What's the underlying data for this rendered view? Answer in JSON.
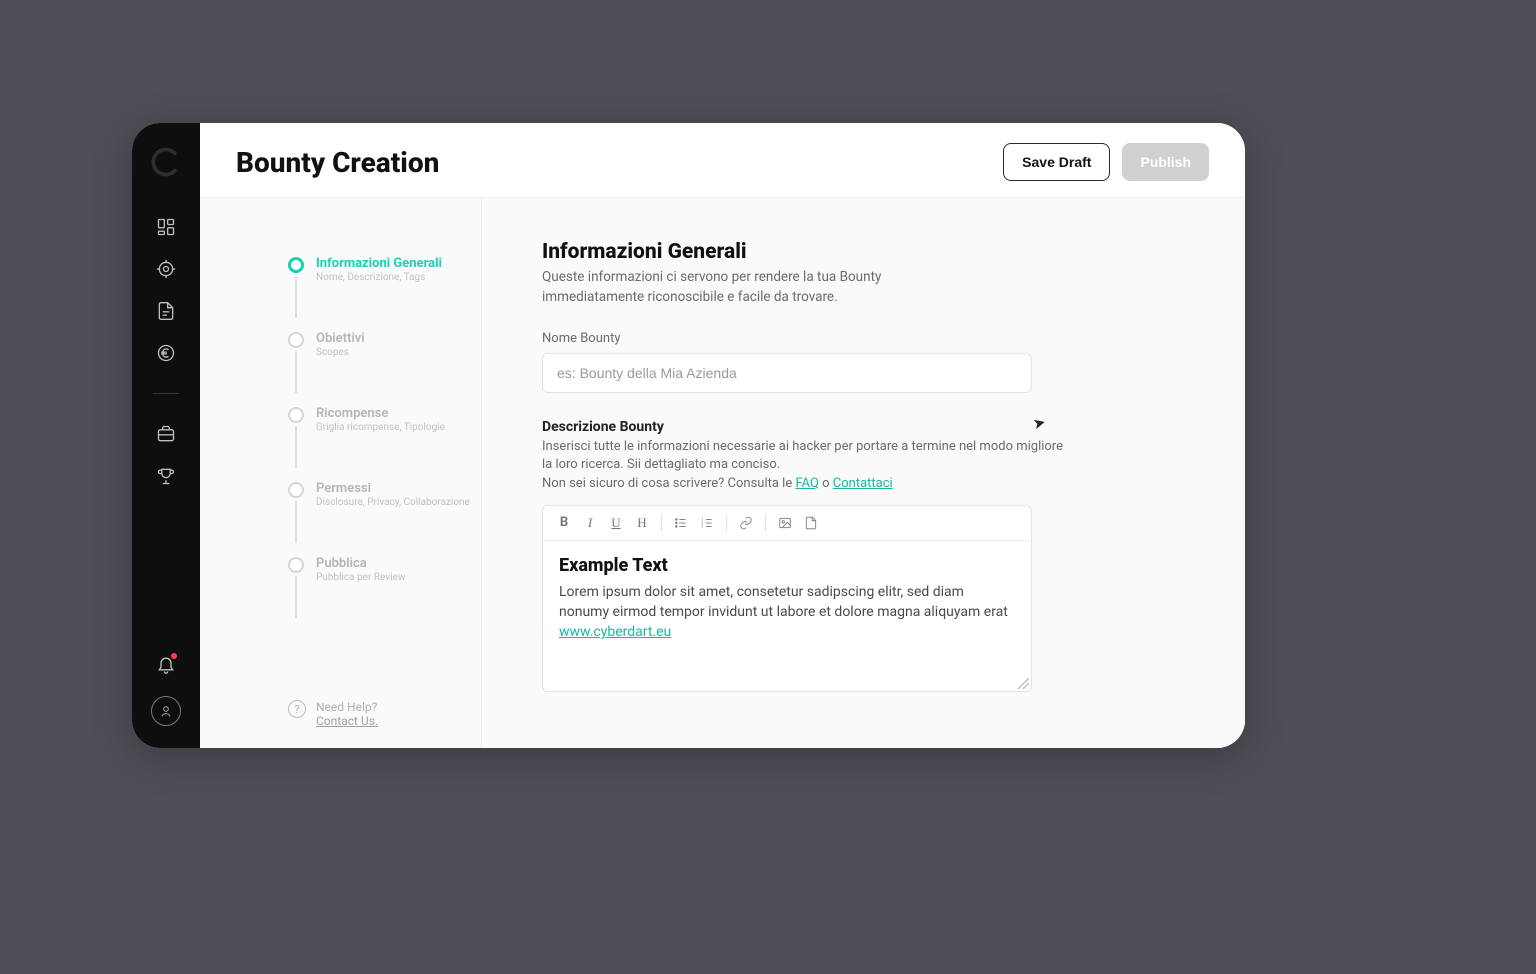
{
  "header": {
    "title": "Bounty Creation",
    "save_draft": "Save Draft",
    "publish": "Publish"
  },
  "steps": [
    {
      "title": "Informazioni Generali",
      "sub": "Nome, Descrizione, Tags",
      "active": true
    },
    {
      "title": "Obiettivi",
      "sub": "Scopes"
    },
    {
      "title": "Ricompense",
      "sub": "Griglia ricompense, Tipologie"
    },
    {
      "title": "Permessi",
      "sub": "Disclosure, Privacy, Collaborazione"
    },
    {
      "title": "Pubblica",
      "sub": "Pubblica per Review"
    }
  ],
  "help": {
    "need": "Need Help?",
    "contact": "Contact Us."
  },
  "form": {
    "section_title": "Informazioni Generali",
    "section_sub": "Queste informazioni ci servono per rendere la tua Bounty immediatamente riconoscibile e facile da trovare.",
    "name_label": "Nome Bounty",
    "name_placeholder": "es: Bounty della Mia Azienda",
    "desc_label": "Descrizione Bounty",
    "desc_help_1": "Inserisci tutte le informazioni necessarie ai hacker per portare a termine nel modo migliore la loro ricerca. Sii dettagliato ma conciso.",
    "desc_help_2a": "Non sei sicuro di cosa scrivere? Consulta le ",
    "desc_help_faq": "FAQ",
    "desc_help_2b": " o ",
    "desc_help_contact": "Contattaci"
  },
  "toolbar": {
    "bold": "B",
    "italic": "I",
    "underline": "U",
    "heading": "H"
  },
  "editor": {
    "heading": "Example Text",
    "body": "Lorem ipsum dolor sit amet, consetetur sadipscing elitr, sed diam nonumy eirmod tempor invidunt ut labore et dolore magna aliquyam erat ",
    "link": "www.cyberdart.eu"
  }
}
